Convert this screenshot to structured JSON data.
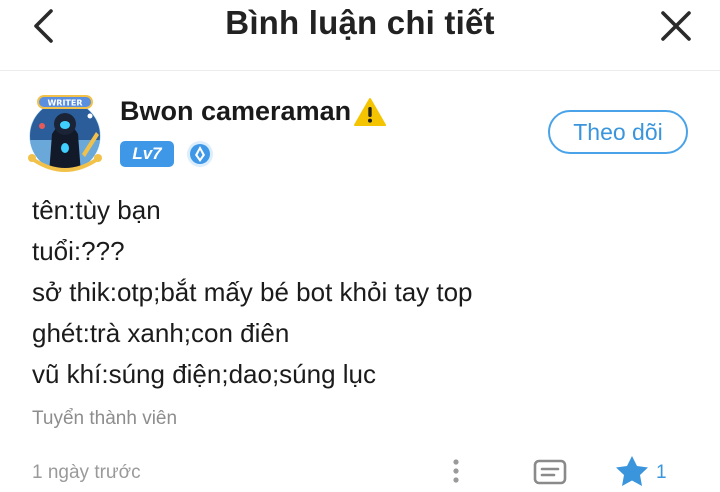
{
  "header": {
    "title": "Bình luận chi tiết",
    "back_icon": "chevron-left-icon",
    "close_icon": "close-icon"
  },
  "author": {
    "name": "Bwon cameraman",
    "name_suffix_icon": "warning-icon",
    "avatar_frame_text": "WRITER",
    "level": "Lv7",
    "medal_icon": "blue-medal-icon",
    "follow_label": "Theo dõi"
  },
  "content": {
    "lines": [
      "tên:tùy bạn",
      "tuổi:???",
      "sở thik:otp;bắt mấy bé bot khỏi tay top",
      "ghét:trà xanh;con điên",
      "vũ khí:súng điện;dao;súng lục"
    ]
  },
  "tag": "Tuyển thành viên",
  "footer": {
    "time": "1 ngày trước",
    "more_icon": "more-vertical-icon",
    "reply_icon": "comment-icon",
    "like_icon": "like-icon",
    "like_count": "1"
  },
  "colors": {
    "accent": "#3a95dd",
    "level_badge": "#3f97e8",
    "muted_text": "#8d8d8d",
    "warning": "#f5c400"
  }
}
